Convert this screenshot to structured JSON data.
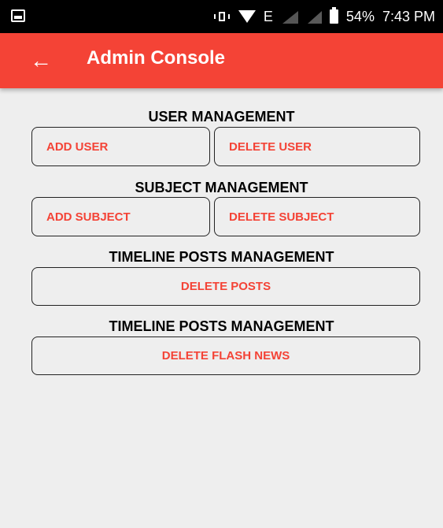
{
  "status_bar": {
    "network_type": "E",
    "battery_percent": "54%",
    "time": "7:43 PM"
  },
  "app_bar": {
    "title": "Admin Console",
    "back_icon": "arrow-left-icon"
  },
  "sections": {
    "user_management": {
      "title": "USER MANAGEMENT",
      "add_label": "ADD USER",
      "delete_label": "DELETE USER"
    },
    "subject_management": {
      "title": "SUBJECT MANAGEMENT",
      "add_label": "ADD SUBJECT",
      "delete_label": "DELETE SUBJECT"
    },
    "timeline_posts": {
      "title": "TIMELINE POSTS MANAGEMENT",
      "delete_label": "DELETE POSTS"
    },
    "flash_news": {
      "title": "TIMELINE POSTS MANAGEMENT",
      "delete_label": "DELETE FLASH NEWS"
    }
  },
  "colors": {
    "accent": "#f44336",
    "background": "#eeeeee",
    "status_bar": "#000000"
  }
}
